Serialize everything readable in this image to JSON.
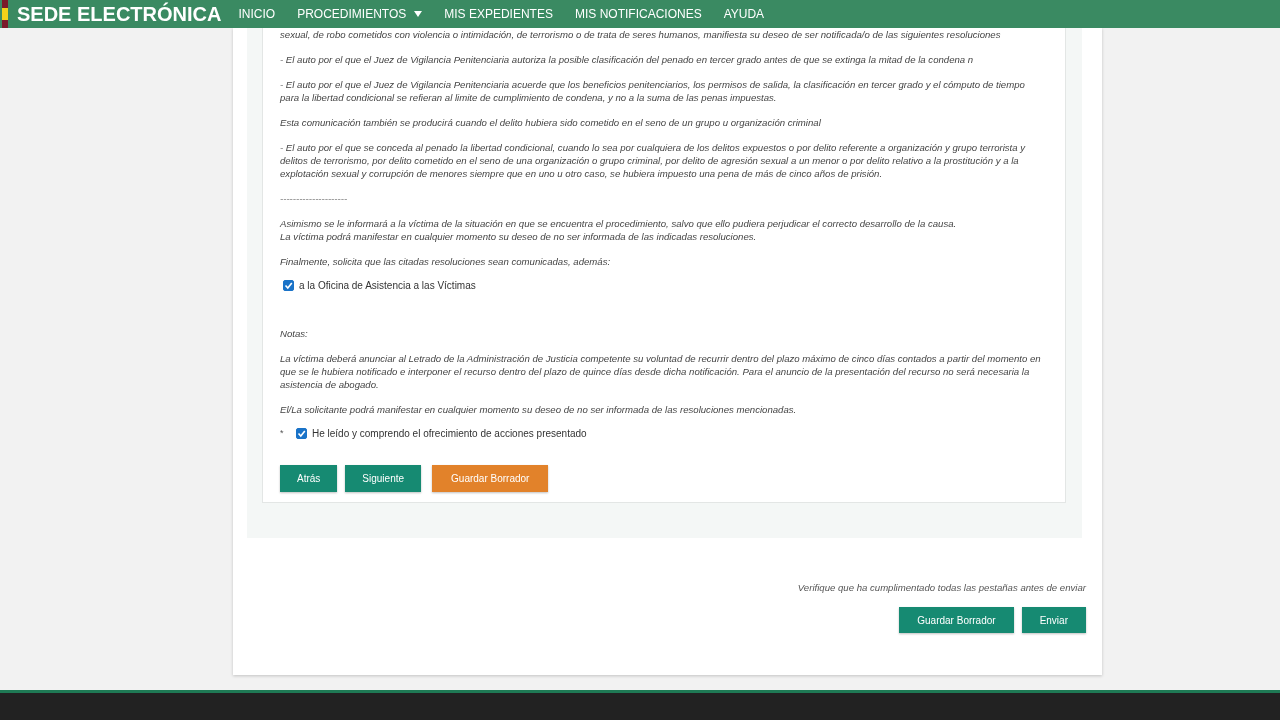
{
  "header": {
    "logo": "SEDE ELECTRÓNICA",
    "nav": [
      {
        "label": "INICIO",
        "has_menu": false
      },
      {
        "label": "PROCEDIMIENTOS",
        "has_menu": true
      },
      {
        "label": "MIS EXPEDIENTES",
        "has_menu": false
      },
      {
        "label": "MIS NOTIFICACIONES",
        "has_menu": false
      },
      {
        "label": "AYUDA",
        "has_menu": false
      }
    ]
  },
  "form": {
    "blocks": [
      {
        "kind": "paragraph",
        "lines": [
          "sexual, de robo cometidos con violencia o intimidación, de terrorismo o de trata de seres humanos, manifiesta su deseo de ser notificada/o de las siguientes resoluciones"
        ]
      },
      {
        "kind": "paragraph",
        "lines": [
          "- El auto por el que el Juez de Vigilancia Penitenciaria autoriza la posible clasificación del penado en tercer grado antes de que se extinga la mitad de la condena n"
        ]
      },
      {
        "kind": "paragraph",
        "lines": [
          "- El auto por el que el Juez de Vigilancia Penitenciaria acuerde que los beneficios penitenciarios, los permisos de salida, la clasificación en tercer grado y el cómputo de tiempo para la libertad condicional se refieran al limite de cumplimiento de condena, y no a la suma de las penas impuestas."
        ]
      },
      {
        "kind": "paragraph",
        "lines": [
          "Esta comunicación también se producirá cuando el delito hubiera sido cometido en el seno de un grupo u organización criminal"
        ]
      },
      {
        "kind": "paragraph",
        "lines": [
          "- El auto por el que se conceda al penado la libertad condicional, cuando lo sea por cualquiera de los delitos expuestos o por delito referente a organización y grupo terrorista y delitos de terrorismo, por delito cometido en el seno de una organización o grupo criminal, por delito de agresión sexual a un menor o por delito relativo a la prostitución y a la explotación sexual y corrupción de menores siempre que  en uno u otro caso, se hubiera impuesto una pena de más de cinco años de prisión."
        ]
      },
      {
        "kind": "separator",
        "lines": [
          "---------------------"
        ]
      },
      {
        "kind": "paragraph",
        "lines": [
          "Asimismo se le informará a la víctima de la situación en que se encuentra el procedimiento, salvo que ello pudiera perjudicar el correcto desarrollo de la causa.",
          "La víctima podrá manifestar en cualquier momento su deseo de no ser informada de las indicadas resoluciones."
        ]
      },
      {
        "kind": "paragraph",
        "lines": [
          "Finalmente, solicita que las citadas resoluciones sean comunicadas, además:"
        ]
      },
      {
        "kind": "checkbox",
        "label": "a la Oficina de Asistencia a las Víctimas",
        "checked": true
      },
      {
        "kind": "paragraph",
        "lines": [
          "Notas:"
        ],
        "spaced": true
      },
      {
        "kind": "paragraph",
        "lines": [
          "La víctima deberá anunciar al Letrado de la Administración de Justicia competente su voluntad de recurrir dentro del plazo máximo de cinco días contados a partir del momento en que se le hubiera notificado e interponer el recurso dentro del plazo de quince días desde dicha notificación. Para el anuncio de la presentación del recurso no será necesaria la asistencia de abogado."
        ]
      },
      {
        "kind": "paragraph",
        "lines": [
          "El/La solicitante podrá manifestar en cualquier momento su deseo de no ser informada de las resoluciones mencionadas."
        ]
      },
      {
        "kind": "checkbox",
        "label": "He leído y comprendo el ofrecimiento de acciones presentado",
        "checked": true,
        "required_mark": "*"
      }
    ],
    "buttons": [
      {
        "label": "Atrás",
        "kind": "primary"
      },
      {
        "label": "Siguiente",
        "kind": "primary"
      },
      {
        "label": "Guardar Borrador",
        "kind": "warning"
      }
    ]
  },
  "submit": {
    "note": "Verifique que ha cumplimentado todas las pestañas antes de enviar",
    "buttons": [
      {
        "label": "Guardar Borrador",
        "kind": "primary"
      },
      {
        "label": "Enviar",
        "kind": "primary"
      }
    ]
  }
}
